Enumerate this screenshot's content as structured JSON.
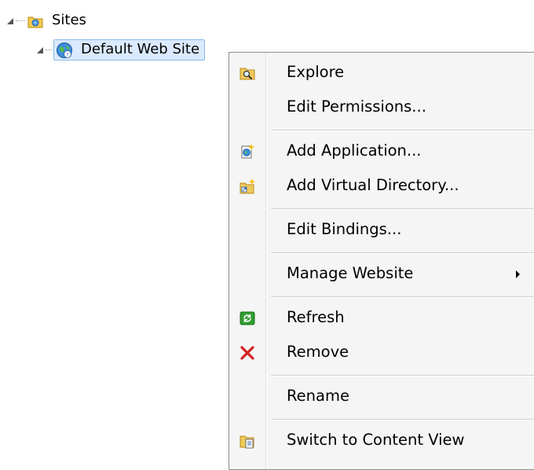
{
  "tree": {
    "root_label": "Sites",
    "child_label": "Default Web Site"
  },
  "menu": {
    "items": [
      {
        "label": "Explore",
        "icon": "explore-icon"
      },
      {
        "label": "Edit Permissions...",
        "icon": ""
      },
      {
        "label": "Add Application...",
        "icon": "add-application-icon"
      },
      {
        "label": "Add Virtual Directory...",
        "icon": "add-virtual-directory-icon"
      },
      {
        "label": "Edit Bindings...",
        "icon": ""
      },
      {
        "label": "Manage Website",
        "icon": "",
        "submenu": true
      },
      {
        "label": "Refresh",
        "icon": "refresh-icon"
      },
      {
        "label": "Remove",
        "icon": "remove-icon"
      },
      {
        "label": "Rename",
        "icon": ""
      },
      {
        "label": "Switch to Content View",
        "icon": "content-view-icon"
      }
    ]
  },
  "colors": {
    "selection_bg": "#dbeafe",
    "selection_border": "#8ab8e8",
    "menu_bg": "#f5f5f5",
    "remove_red": "#d42020",
    "refresh_green": "#2f9e2f"
  }
}
